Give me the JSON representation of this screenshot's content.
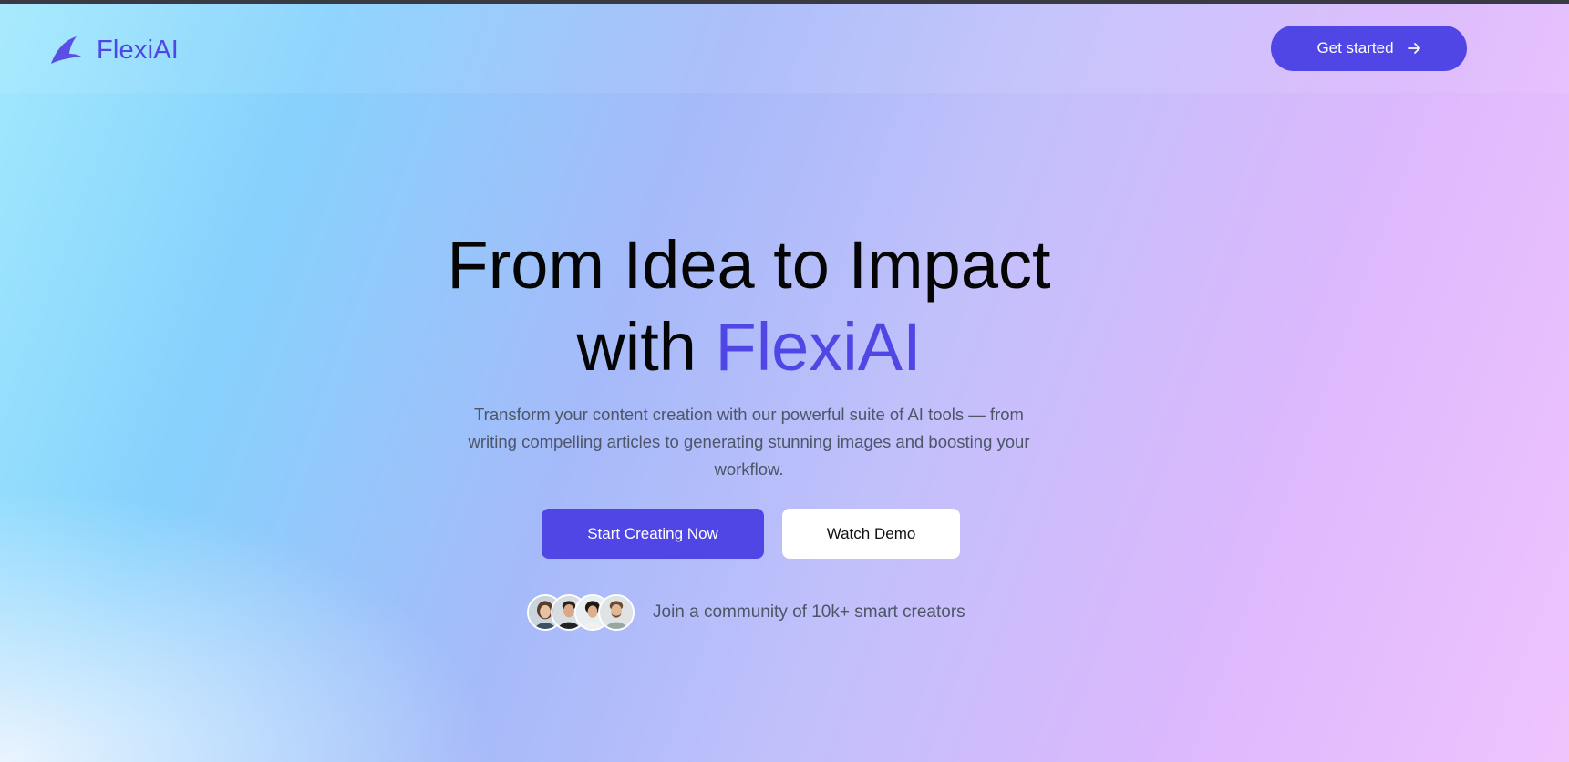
{
  "brand": {
    "name": "FlexiAI",
    "icon": "flexiai-logo-icon"
  },
  "header": {
    "cta_label": "Get started",
    "cta_icon": "arrow-right-icon"
  },
  "hero": {
    "title_line1": "From Idea to Impact",
    "title_line2_prefix": "with ",
    "title_line2_accent": "FlexiAI",
    "subtitle": "Transform your content creation with our powerful suite of AI tools — from writing compelling articles to generating stunning images and boosting your workflow.",
    "primary_button": "Start Creating Now",
    "secondary_button": "Watch Demo"
  },
  "community": {
    "text": "Join a community of 10k+ smart creators",
    "avatar_count": 4
  },
  "colors": {
    "accent": "#4f46e5",
    "title": "#050505",
    "muted_text": "#4d5567",
    "background_from": "#a2e9fd",
    "background_to": "#efc4fd"
  }
}
